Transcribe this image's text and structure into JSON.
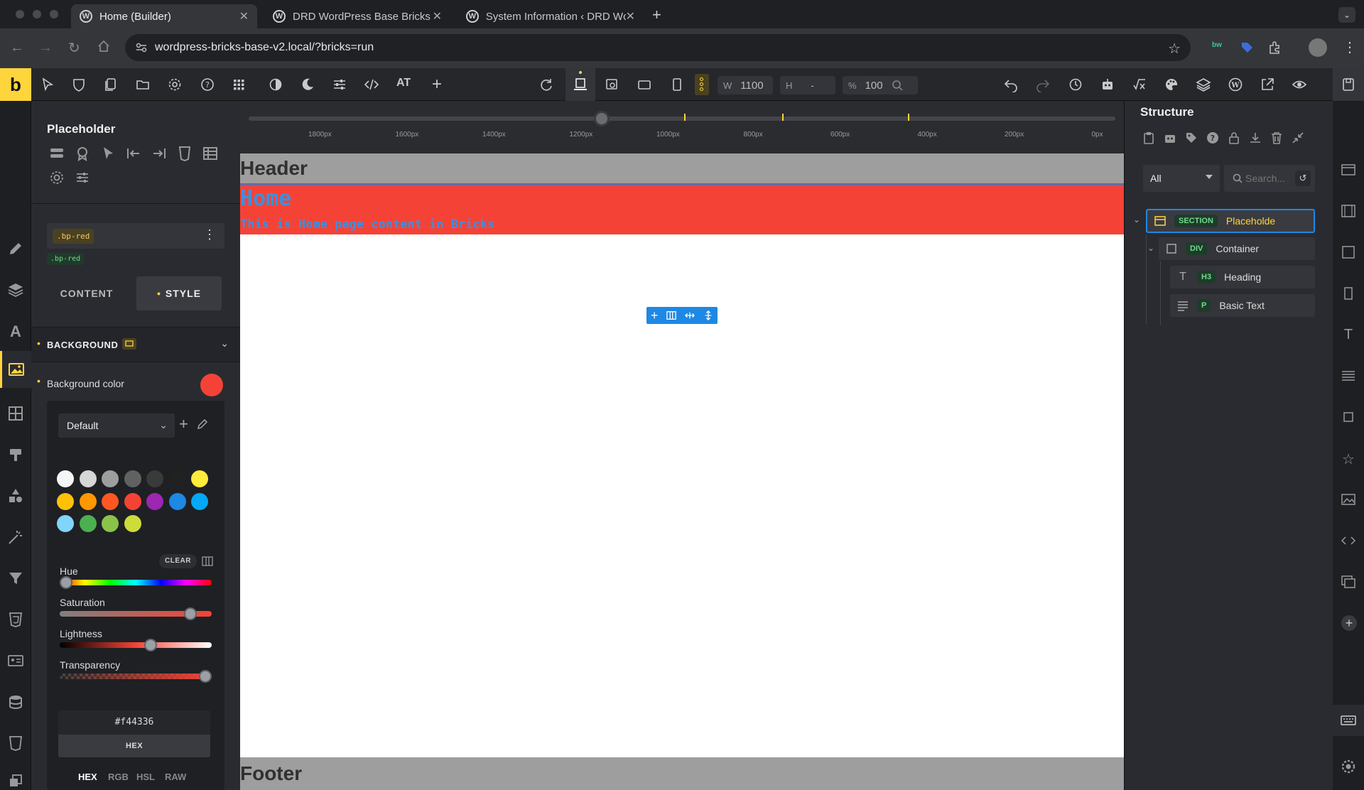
{
  "browser": {
    "tabs": [
      {
        "title": "Home (Builder)",
        "active": true
      },
      {
        "title": "DRD WordPress Base Bricks",
        "active": false
      },
      {
        "title": "System Information ‹ DRD Wc",
        "active": false
      }
    ],
    "new_tab": "+",
    "url": "wordpress-bricks-base-v2.local/?bricks=run"
  },
  "toolbar": {
    "logo": "b",
    "at_label": "AT",
    "width_label": "W",
    "width_value": "1100",
    "height_label": "H",
    "height_value": "-",
    "zoom_label": "%",
    "zoom_value": "100"
  },
  "left_panel": {
    "title": "Placeholder",
    "class_badge": ".bp-red",
    "class_badge_small": ".bp-red",
    "tabs": {
      "content": "CONTENT",
      "style": "STYLE"
    },
    "section": "BACKGROUND",
    "bg_color_label": "Background color",
    "bg_color": "#f44336",
    "picker": {
      "palette": "Default",
      "clear": "CLEAR",
      "swatches": [
        "#f5f5f5",
        "#d6d6d6",
        "#9e9e9e",
        "#616161",
        "#3a3a3a",
        "#212121",
        "#ffeb3b",
        "#ffc107",
        "#ff9800",
        "#ff5722",
        "#f44336",
        "#9c27b0",
        "#1e88e5",
        "#03a9f4",
        "#81d4fa",
        "#4caf50",
        "#8bc34a",
        "#cddc39"
      ],
      "hue_label": "Hue",
      "saturation_label": "Saturation",
      "lightness_label": "Lightness",
      "transparency_label": "Transparency",
      "hue": 0.04,
      "saturation": 0.86,
      "lightness": 0.6,
      "transparency": 0.96,
      "hex_value": "#f44336",
      "format_button": "HEX",
      "formats": [
        "HEX",
        "RGB",
        "HSL",
        "RAW"
      ]
    }
  },
  "canvas": {
    "ruler_labels": [
      "1800px",
      "1600px",
      "1400px",
      "1200px",
      "1000px",
      "800px",
      "600px",
      "400px",
      "200px",
      "0px"
    ],
    "header": "Header",
    "home_heading": "Home",
    "home_text": "This is Home page content in Bricks",
    "footer": "Footer"
  },
  "structure": {
    "title": "Structure",
    "filter": "All",
    "search_placeholder": "Search...",
    "nodes": [
      {
        "tag": "SECTION",
        "label": "Placeholde",
        "depth": 0
      },
      {
        "tag": "DIV",
        "label": "Container",
        "depth": 1
      },
      {
        "tag": "H3",
        "label": "Heading",
        "depth": 2
      },
      {
        "tag": "P",
        "label": "Basic Text",
        "depth": 2
      }
    ]
  },
  "colors": {
    "accent": "#ffd53d",
    "section_red": "#f44336",
    "selection_blue": "#1e88e5"
  }
}
